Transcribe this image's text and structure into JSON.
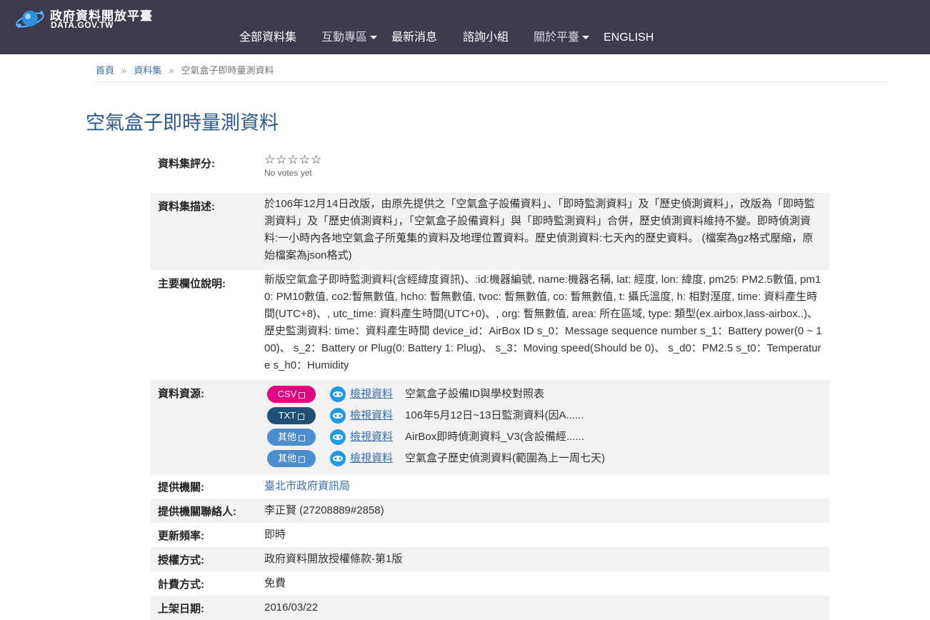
{
  "header": {
    "site_title": "政府資料開放平臺",
    "site_url": "DATA.GOV.TW",
    "nav": [
      {
        "label": "全部資料集",
        "dropdown": false
      },
      {
        "label": "互動專區",
        "dropdown": true
      },
      {
        "label": "最新消息",
        "dropdown": false
      },
      {
        "label": "諮詢小組",
        "dropdown": false
      },
      {
        "label": "關於平臺",
        "dropdown": true
      },
      {
        "label": "ENGLISH",
        "dropdown": false
      }
    ]
  },
  "breadcrumb": {
    "home": "首頁",
    "datasets": "資料集",
    "current": "空氣盒子即時量測資料",
    "separator": "»"
  },
  "page_title": "空氣盒子即時量測資料",
  "info": {
    "rating_label": "資料集評分:",
    "rating_stars": "☆☆☆☆☆",
    "rating_votes": "No votes yet",
    "description_label": "資料集描述:",
    "description": "於106年12月14日改版，由原先提供之「空氣盒子設備資料」、「即時監測資料」及「歷史偵測資料」，改版為「即時監測資料」及「歷史偵測資料」，「空氣盒子設備資料」與「即時監測資料」合併，歷史偵測資料維持不變。即時偵測資料:一小時內各地空氣盒子所蒐集的資料及地理位置資料。歷史偵測資料:七天內的歷史資料。 (檔案為gz格式壓縮，原始檔案為json格式)",
    "fields_label": "主要欄位說明:",
    "fields": "新版空氣盒子即時監測資料(含經緯度資訊)、:id:機器編號, name:機器名稱, lat: 經度, lon: 緯度, pm25: PM2.5數值, pm10: PM10數值, co2:暫無數值, hcho: 暫無數值, tvoc: 暫無數值, co: 暫無數值, t: 攝氏溫度, h: 相對溼度, time: 資料產生時間(UTC+8)、, utc_time: 資料產生時間(UTC+0)、, org: 暫無數值, area: 所在區域, type: 類型(ex.airbox,lass-airbox..)、歷史監測資料: time：資料產生時間 device_id：AirBox ID s_0：Message sequence number s_1：Battery power(0 ~ 100)、 s_2：Battery or Plug(0: Battery 1: Plug)、 s_3：Moving speed(Should be 0)、 s_d0：PM2.5 s_t0：Temperature s_h0：Humidity",
    "resources_label": "資料資源:",
    "resources": [
      {
        "format": "CSV",
        "color": "#e5007f",
        "view": "檢視資料",
        "name": "空氣盒子設備ID與學校對照表"
      },
      {
        "format": "TXT",
        "color": "#1f4f75",
        "view": "檢視資料",
        "name": "106年5月12日~13日監測資料(因A......"
      },
      {
        "format": "其他",
        "color": "#4a8ed0",
        "view": "檢視資料",
        "name": "AirBox即時偵測資料_V3(含設備經......"
      },
      {
        "format": "其他",
        "color": "#4a8ed0",
        "view": "檢視資料",
        "name": "空氣盒子歷史偵測資料(範圍為上一周七天)"
      }
    ],
    "provider_label": "提供機關:",
    "provider": "臺北市政府資訊局",
    "contact_label": "提供機關聯絡人:",
    "contact": "李正賢 (27208889#2858)",
    "frequency_label": "更新頻率:",
    "frequency": "即時",
    "license_label": "授權方式:",
    "license": "政府資料開放授權條款-第1版",
    "fee_label": "計費方式:",
    "fee": "免費",
    "launch_label": "上架日期:",
    "launch": "2016/03/22"
  }
}
